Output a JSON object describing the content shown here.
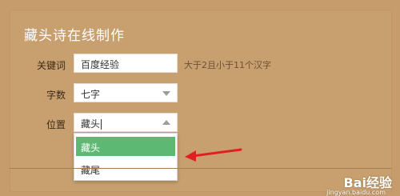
{
  "header": {
    "title": "藏头诗在线制作"
  },
  "form": {
    "keyword": {
      "label": "关键词",
      "value": "百度经验",
      "hint": "大于2且小于11个汉字"
    },
    "count": {
      "label": "字数",
      "value": "七字"
    },
    "position": {
      "label": "位置",
      "value": "藏头",
      "options": [
        {
          "label": "藏头",
          "selected": true
        },
        {
          "label": "藏尾",
          "selected": false
        }
      ]
    }
  },
  "watermark": {
    "brand": "Bai经验",
    "url": "jingyan.baidu.com"
  },
  "colors": {
    "background": "#c69c6d",
    "selected_option": "#5cb873",
    "arrow": "#e02020"
  }
}
